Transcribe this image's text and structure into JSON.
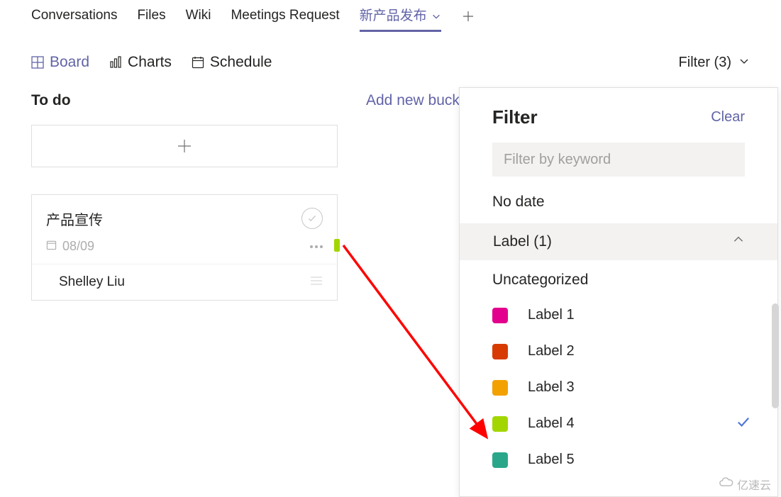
{
  "tabs": {
    "conversations": "Conversations",
    "files": "Files",
    "wiki": "Wiki",
    "meetings": "Meetings Request",
    "active": "新产品发布"
  },
  "views": {
    "board": "Board",
    "charts": "Charts",
    "schedule": "Schedule"
  },
  "filter_trigger": "Filter (3)",
  "columns": {
    "todo": "To do",
    "addnew": "Add new bucket"
  },
  "card": {
    "title": "产品宣传",
    "date": "08/09",
    "assignee": "Shelley Liu"
  },
  "filter": {
    "title": "Filter",
    "clear": "Clear",
    "search_placeholder": "Filter by keyword",
    "no_date": "No date",
    "label_header": "Label (1)",
    "uncategorized": "Uncategorized",
    "labels": [
      {
        "name": "Label 1",
        "color": "#e3008c"
      },
      {
        "name": "Label 2",
        "color": "#d83b01"
      },
      {
        "name": "Label 3",
        "color": "#f2a100"
      },
      {
        "name": "Label 4",
        "color": "#a3d600",
        "checked": true
      },
      {
        "name": "Label 5",
        "color": "#2aa78b"
      }
    ]
  },
  "watermark": "亿速云"
}
